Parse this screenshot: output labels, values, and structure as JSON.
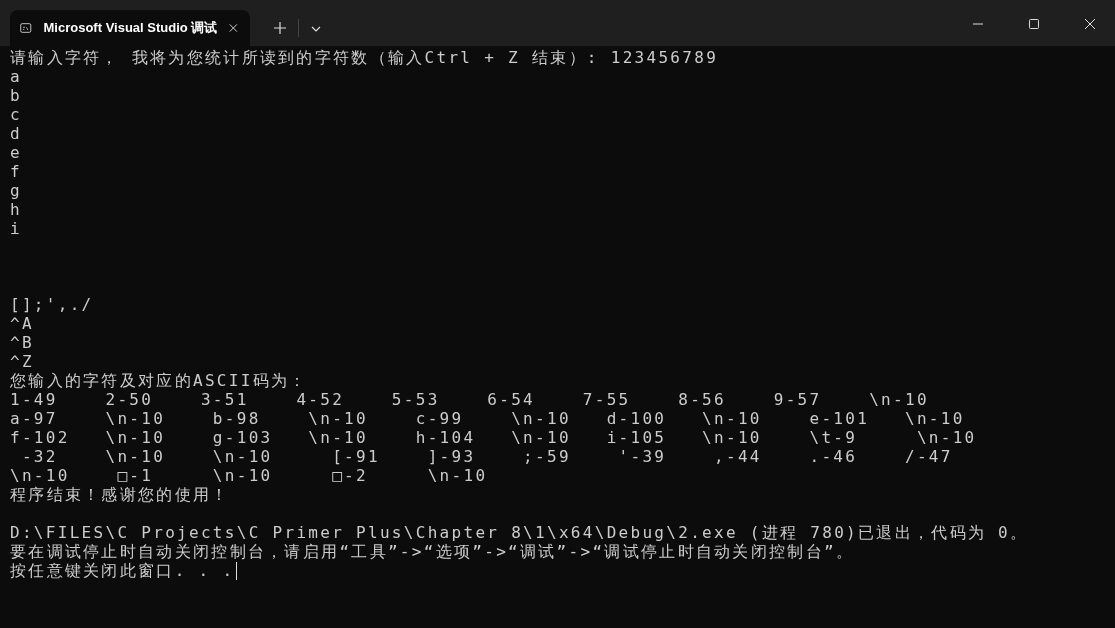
{
  "window": {
    "tab": {
      "title": "Microsoft Visual Studio 调试",
      "selected": true
    }
  },
  "console": {
    "blocks": [
      {
        "kind": "echo",
        "lines": [
          "请输入字符， 我将为您统计所读到的字符数（输入Ctrl + Z 结束）: 123456789",
          "a",
          "b",
          "c",
          "d",
          "e",
          "f",
          "g",
          "h",
          "i"
        ]
      },
      {
        "kind": "report",
        "lines": [
          "[];',./",
          "^A",
          "^B",
          "^Z",
          "您输入的字符及对应的ASCII码为：",
          "1-49    2-50    3-51    4-52    5-53    6-54    7-55    8-56    9-57    \\n-10",
          "a-97    \\n-10    b-98    \\n-10    c-99    \\n-10   d-100   \\n-10    e-101   \\n-10",
          "f-102   \\n-10    g-103   \\n-10    h-104   \\n-10   i-105   \\n-10    \\t-9     \\n-10",
          " -32    \\n-10    \\n-10     [-91    ]-93    ;-59    '-39    ,-44    .-46    /-47",
          "\\n-10    □-1     \\n-10     □-2     \\n-10",
          "程序结束！感谢您的使用！"
        ]
      },
      {
        "kind": "exit",
        "lines": [
          "D:\\FILES\\C Projects\\C Primer Plus\\Chapter 8\\1\\x64\\Debug\\2.exe (进程 780)已退出，代码为 0。",
          "要在调试停止时自动关闭控制台，请启用“工具”->“选项”->“调试”->“调试停止时自动关闭控制台”。",
          "按任意键关闭此窗口. . ."
        ]
      }
    ]
  }
}
